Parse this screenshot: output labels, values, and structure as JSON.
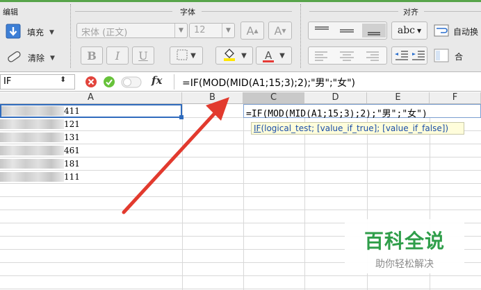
{
  "ribbon": {
    "groups": {
      "edit": "编辑",
      "font": "字体",
      "align": "对齐"
    },
    "fill_label": "填充",
    "clear_label": "清除",
    "font_name": "宋体 (正文)",
    "font_size": "12",
    "grow_label": "A",
    "shrink_label": "A",
    "bold_label": "B",
    "italic_label": "I",
    "underline_label": "U",
    "font_color_label": "A",
    "abc_label": "abc",
    "wrap_label": "自动换",
    "merge_label": "合",
    "colors": {
      "highlight": "#ffe600",
      "font_color": "#e53935",
      "accent": "#57a44a"
    }
  },
  "formula_bar": {
    "name_box": "IF",
    "fx_label": "fx",
    "formula": "=IF(MOD(MID(A1;15;3);2);\"男\";\"女\")"
  },
  "grid": {
    "columns": [
      "A",
      "B",
      "C",
      "D",
      "E",
      "F"
    ],
    "rows": [
      "411",
      "121",
      "131",
      "461",
      "181",
      "111"
    ],
    "editing_formula": "=IF(MOD(MID(A1;15;3);2);\"男\";\"女\")",
    "tooltip_fn": "IF",
    "tooltip_args": "(logical_test; [value_if_true]; [value_if_false])"
  },
  "watermark": {
    "title": "百科全说",
    "subtitle": "助你轻松解决"
  }
}
